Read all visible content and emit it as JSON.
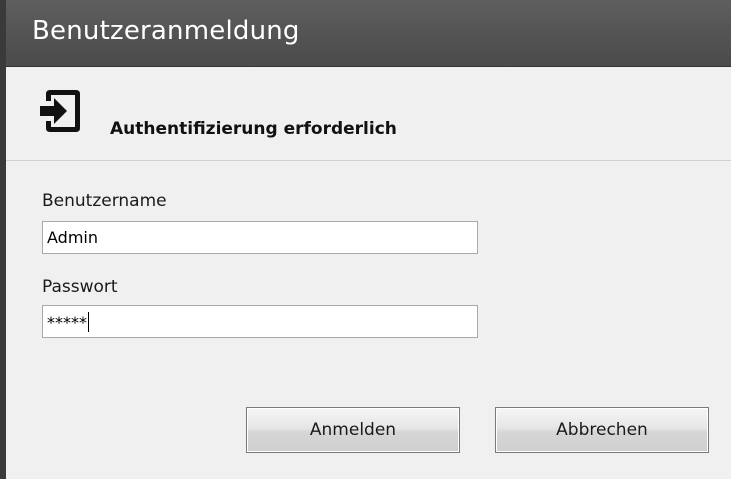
{
  "window": {
    "title": "Benutzeranmeldung"
  },
  "header": {
    "icon": "login-arrow-icon",
    "title": "Authentifizierung erforderlich"
  },
  "form": {
    "username_label": "Benutzername",
    "username_value": "Admin",
    "password_label": "Passwort",
    "password_value": "*****"
  },
  "buttons": {
    "login_label": "Anmelden",
    "cancel_label": "Abbrechen"
  }
}
